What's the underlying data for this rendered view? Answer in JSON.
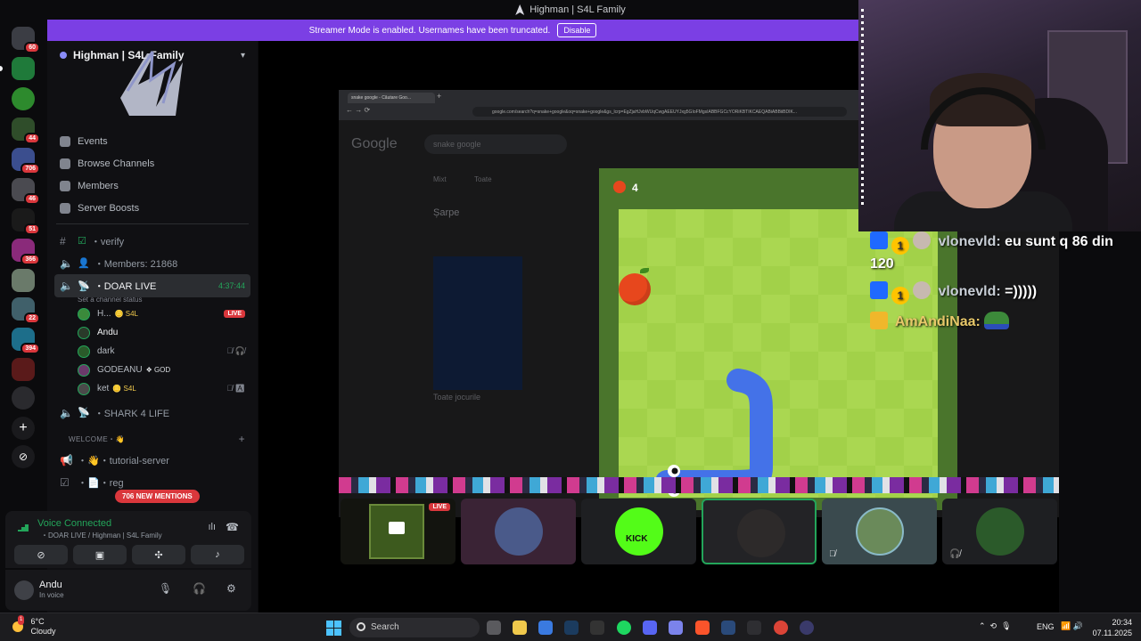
{
  "window": {
    "title": "Highman | S4L Family"
  },
  "banner": {
    "text": "Streamer Mode is enabled. Usernames have been truncated.",
    "button": "Disable"
  },
  "rail": {
    "badges": [
      "60",
      "44",
      "706",
      "46",
      "51",
      "366",
      "22",
      "394"
    ]
  },
  "server": {
    "name": "Highman | S4L Family",
    "nav": [
      {
        "label": "Events",
        "icon": "calendar-icon"
      },
      {
        "label": "Browse Channels",
        "icon": "list-icon"
      },
      {
        "label": "Members",
        "icon": "members-icon"
      },
      {
        "label": "Server Boosts",
        "icon": "boost-icon"
      }
    ],
    "channels": {
      "verify": "・verify",
      "members_count": "・Members: 21868",
      "doar_live": "・DOAR LIVE",
      "doar_live_time": "4:37:44",
      "doar_live_status": "Set a channel status",
      "shark": "・SHARK 4 LIFE",
      "category": "WELCOME・👋",
      "tutorial": "・👋・tutorial-server",
      "reguli": "・📄・reg"
    },
    "members": [
      {
        "name": "H...",
        "tag": "🪙 S4L",
        "live": "LIVE"
      },
      {
        "name": "Andu",
        "tag": ""
      },
      {
        "name": "dark",
        "tag": ""
      },
      {
        "name": "GODEANU",
        "tag": "❖ GOD"
      },
      {
        "name": "ket",
        "tag": "🪙 S4L"
      }
    ],
    "mentions": "706 NEW MENTIONS"
  },
  "voice": {
    "title": "Voice Connected",
    "subtitle": "・DOAR LIVE / Highman | S4L Family"
  },
  "user": {
    "name": "Andu",
    "status": "In voice"
  },
  "browser": {
    "tab_title": "snake google - Căutare Goo...",
    "url": "google.com/search?q=snake+google&oq=snake+google&gs_lcrp=EgZjaHJvbWUqCwgAEEUYJxg5GIoFMgsIABBFGCcYORiKBTIKCAEQABiABBiiBDIK...",
    "logo": "Google",
    "query": "snake google",
    "tabs": [
      "Mixt",
      "Toate"
    ],
    "heading": "Șarpe",
    "games_label": "Toate jocurile"
  },
  "game": {
    "score": "4"
  },
  "chat": [
    {
      "user": "vlonevld:",
      "text": "eu sunt q 86 din 120"
    },
    {
      "user": "vlonevld:",
      "text": "=)))))"
    },
    {
      "user": "AmAndiNaa:",
      "text": ""
    }
  ],
  "tiles": [
    {
      "live": "LIVE"
    },
    {
      "label": ""
    },
    {
      "label": "KICK"
    },
    {
      "label": ""
    },
    {
      "label": ""
    },
    {
      "label": ""
    }
  ],
  "taskbar": {
    "weather_temp": "6°C",
    "weather_desc": "Cloudy",
    "weather_alert": "1",
    "search": "Search",
    "lang": "ENG",
    "time": "20:34",
    "date": "07.11.2025"
  }
}
